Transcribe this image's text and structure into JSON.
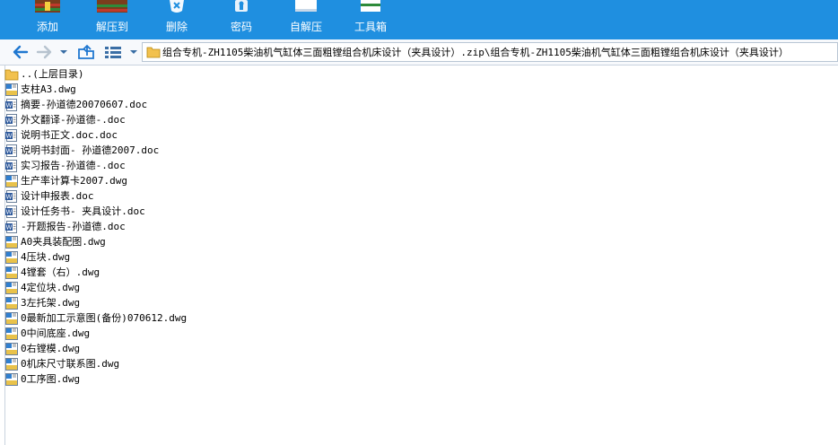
{
  "toolbar": {
    "buttons": [
      {
        "label": "添加",
        "icon": "add-archive-icon"
      },
      {
        "label": "解压到",
        "icon": "extract-to-icon"
      },
      {
        "label": "删除",
        "icon": "delete-icon"
      },
      {
        "label": "密码",
        "icon": "password-icon"
      },
      {
        "label": "自解压",
        "icon": "self-extract-icon"
      },
      {
        "label": "工具箱",
        "icon": "toolbox-icon"
      }
    ]
  },
  "address": {
    "path": "组合专机-ZH1105柴油机气缸体三面粗镗组合机床设计（夹具设计）.zip\\组合专机-ZH1105柴油机气缸体三面粗镗组合机床设计（夹具设计）"
  },
  "files": [
    {
      "name": "..(上层目录)",
      "type": "folder"
    },
    {
      "name": "支柱A3.dwg",
      "type": "dwg"
    },
    {
      "name": "摘要-孙道德20070607.doc",
      "type": "doc"
    },
    {
      "name": "外文翻译-孙道德-.doc",
      "type": "doc"
    },
    {
      "name": "说明书正文.doc.doc",
      "type": "doc"
    },
    {
      "name": "说明书封面- 孙道德2007.doc",
      "type": "doc"
    },
    {
      "name": "实习报告-孙道德-.doc",
      "type": "doc"
    },
    {
      "name": "生产率计算卡2007.dwg",
      "type": "dwg"
    },
    {
      "name": "设计申报表.doc",
      "type": "doc"
    },
    {
      "name": "设计任务书- 夹具设计.doc",
      "type": "doc"
    },
    {
      "name": "-开题报告-孙道德.doc",
      "type": "doc"
    },
    {
      "name": "A0夹具装配图.dwg",
      "type": "dwg"
    },
    {
      "name": "4压块.dwg",
      "type": "dwg"
    },
    {
      "name": "4镗套（右）.dwg",
      "type": "dwg"
    },
    {
      "name": "4定位块.dwg",
      "type": "dwg"
    },
    {
      "name": "3左托架.dwg",
      "type": "dwg"
    },
    {
      "name": "0最新加工示意图(备份)070612.dwg",
      "type": "dwg"
    },
    {
      "name": "0中间底座.dwg",
      "type": "dwg"
    },
    {
      "name": "0右镗模.dwg",
      "type": "dwg"
    },
    {
      "name": "0机床尺寸联系图.dwg",
      "type": "dwg"
    },
    {
      "name": "0工序图.dwg",
      "type": "dwg"
    }
  ],
  "colors": {
    "toolbar_bg": "#1f8fe0",
    "folder": "#f2c14e",
    "dwg_accent": "#2f7fd1",
    "doc_accent": "#2b579a"
  }
}
